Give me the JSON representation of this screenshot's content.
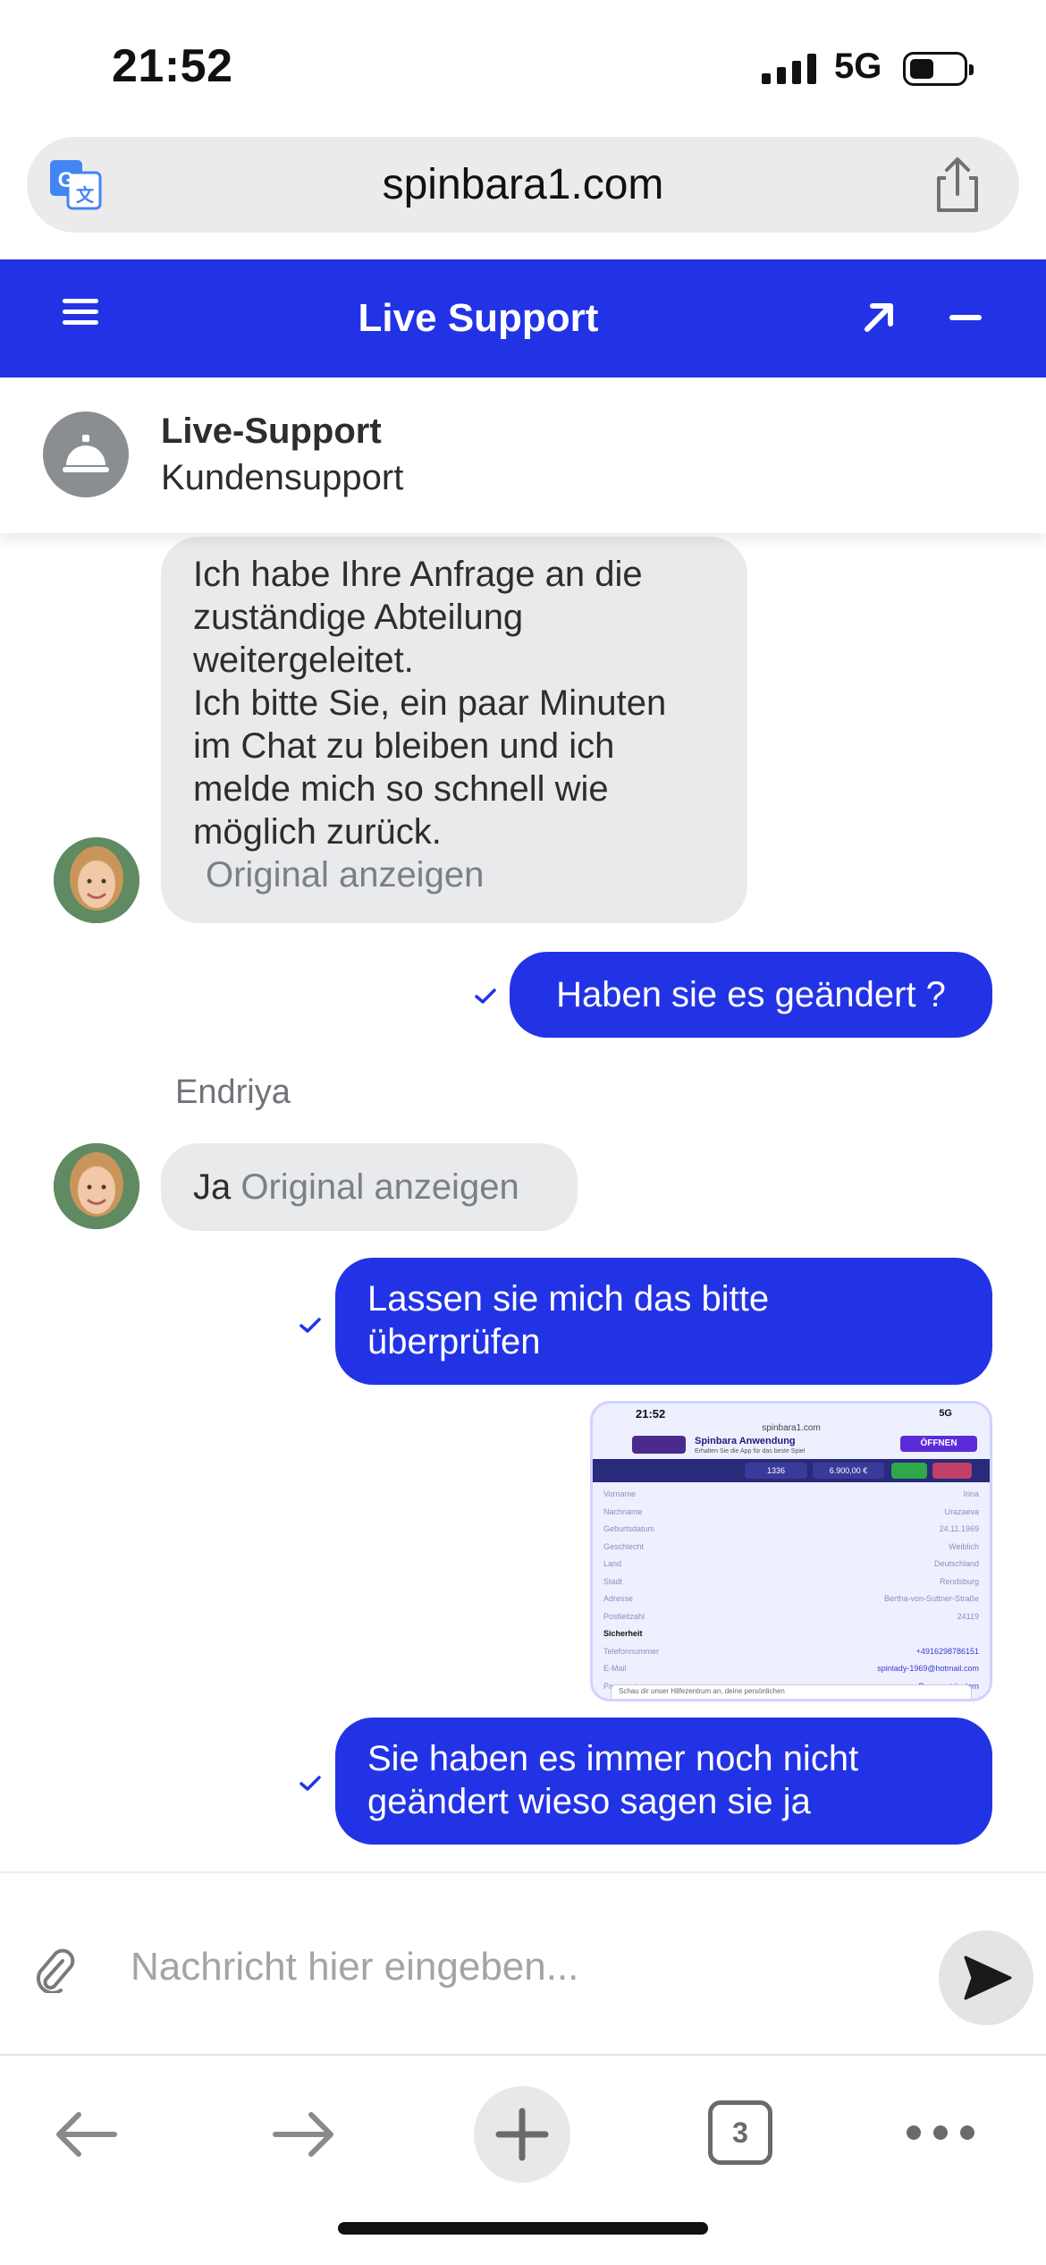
{
  "status_bar": {
    "time": "21:52",
    "network": "5G"
  },
  "browser": {
    "url": "spinbara1.com",
    "tab_count": "3"
  },
  "header": {
    "title": "Live Support"
  },
  "agent": {
    "name": "Live-Support",
    "subtitle": "Kundensupport"
  },
  "messages": {
    "m1_lines": [
      "Ich habe Ihre Anfrage an die",
      "zuständige Abteilung",
      "weitergeleitet.",
      "Ich bitte Sie, ein paar Minuten",
      "im Chat zu bleiben und ich",
      "melde mich so schnell wie",
      "möglich zurück."
    ],
    "show_original": "Original anzeigen",
    "m2": "Haben sie es geändert ?",
    "sender_name": "Endriya",
    "m3": "Ja",
    "m4_lines": [
      "Lassen sie mich das bitte",
      "überprüfen"
    ],
    "m6_lines": [
      "Sie haben es immer noch nicht",
      "geändert wieso sagen sie ja"
    ]
  },
  "screenshot_thumb": {
    "time": "21:52",
    "net": "5G",
    "url": "spinbara1.com",
    "app_title": "Spinbara Anwendung",
    "app_sub": "Erhalten Sie die App für das beste Spiel",
    "open_label": "ÖFFNEN",
    "counter": "1336",
    "balance": "6.900,00 €",
    "fields": [
      {
        "label": "Vorname",
        "value": "Irina"
      },
      {
        "label": "Nachname",
        "value": "Urazaeva"
      },
      {
        "label": "Geburtsdatum",
        "value": "24.11.1969"
      },
      {
        "label": "Geschlecht",
        "value": "Weiblich"
      },
      {
        "label": "Land",
        "value": "Deutschland"
      },
      {
        "label": "Stadt",
        "value": "Rendsburg"
      },
      {
        "label": "Adresse",
        "value": "Bertha-von-Suttner-Straße"
      },
      {
        "label": "Postleitzahl",
        "value": "24119"
      }
    ],
    "section": "Sicherheit",
    "fields2": [
      {
        "label": "Telefonnummer",
        "value": "+4916298786151"
      },
      {
        "label": "E-Mail",
        "value": "spinlady-1969@hotmail.com"
      },
      {
        "label": "Passwort",
        "value": "Passwort ändern"
      }
    ],
    "footer": "Schau dir unser Hilfezentrum an, deine persönlichen"
  },
  "composer": {
    "placeholder": "Nachricht hier eingeben..."
  },
  "colors": {
    "accent": "#2233e6",
    "incoming_bubble": "#e9eaec"
  }
}
